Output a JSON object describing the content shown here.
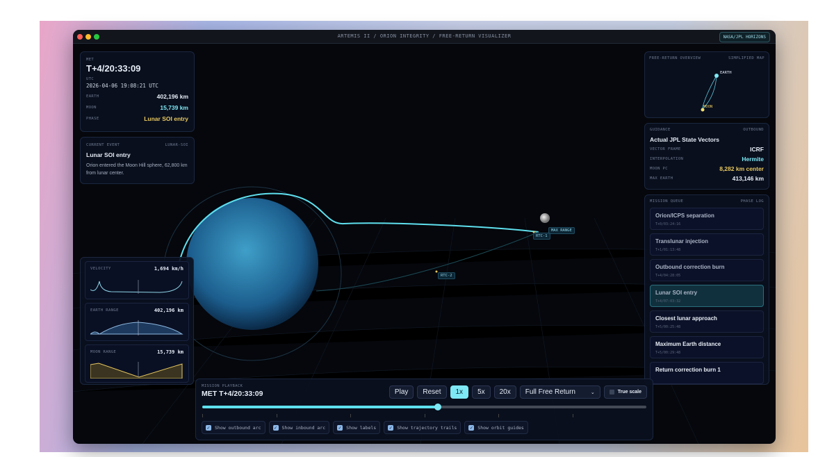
{
  "window": {
    "title": "ARTEMIS II / ORION INTEGRITY / FREE-RETURN VISUALIZER",
    "source_badge": "NASA/JPL HORIZONS"
  },
  "status": {
    "met_label": "MET",
    "met": "T+4/20:33:09",
    "utc_label": "UTC",
    "utc": "2026-04-06 19:08:21 UTC",
    "earth_label": "EARTH",
    "earth": "402,196 km",
    "moon_label": "MOON",
    "moon": "15,739 km",
    "phase_label": "PHASE",
    "phase": "Lunar SOI entry"
  },
  "event": {
    "label": "CURRENT EVENT",
    "code": "LUNAR-SOI",
    "title": "Lunar SOI entry",
    "desc": "Orion entered the Moon Hill sphere, 62,800 km from lunar center."
  },
  "charts": [
    {
      "label": "VELOCITY",
      "value": "1,694 km/h"
    },
    {
      "label": "EARTH RANGE",
      "value": "402,196 km"
    },
    {
      "label": "MOON RANGE",
      "value": "15,739 km"
    }
  ],
  "scene_labels": {
    "max_range": "MAX RANGE",
    "rtc1": "RTC-1",
    "rtc2": "RTC-2"
  },
  "overview": {
    "label": "FREE-RETURN OVERVIEW",
    "right": "SIMPLIFIED MAP",
    "earth": "EARTH",
    "moon": "MOON"
  },
  "guidance": {
    "label": "GUIDANCE",
    "right": "OUTBOUND",
    "title": "Actual JPL State Vectors",
    "rows": [
      {
        "k": "VECTOR FRAME",
        "v": "ICRF"
      },
      {
        "k": "INTERPOLATION",
        "v": "Hermite"
      },
      {
        "k": "MOON PC",
        "v": "8,282 km center"
      },
      {
        "k": "MAX EARTH",
        "v": "413,146 km"
      }
    ]
  },
  "queue": {
    "label": "MISSION QUEUE",
    "right": "PHASE LOG",
    "items": [
      {
        "name": "Orion/ICPS separation",
        "time": "T+0/03:24:16"
      },
      {
        "name": "Translunar injection",
        "time": "T+1/01:13:48"
      },
      {
        "name": "Outbound correction burn",
        "time": "T+4/04:28:05"
      },
      {
        "name": "Lunar SOI entry",
        "time": "T+4/07:03:32"
      },
      {
        "name": "Closest lunar approach",
        "time": "T+5/00:25:48"
      },
      {
        "name": "Maximum Earth distance",
        "time": "T+5/00:29:48"
      },
      {
        "name": "Return correction burn 1",
        "time": ""
      }
    ]
  },
  "playback": {
    "label": "MISSION PLAYBACK",
    "met": "MET T+4/20:33:09",
    "play": "Play",
    "reset": "Reset",
    "speeds": [
      "1x",
      "5x",
      "20x"
    ],
    "active_speed": "1x",
    "mode": "Full Free Return",
    "true_scale": "True scale",
    "true_scale_checked": false,
    "progress": 0.53,
    "toggles": [
      {
        "label": "Show outbound arc",
        "checked": true
      },
      {
        "label": "Show inbound arc",
        "checked": true
      },
      {
        "label": "Show labels",
        "checked": true
      },
      {
        "label": "Show trajectory trails",
        "checked": true
      },
      {
        "label": "Show orbit guides",
        "checked": true
      }
    ]
  },
  "colors": {
    "accent": "#7ee8f5",
    "gold": "#e8c860",
    "earth": "#2f7fb8"
  }
}
